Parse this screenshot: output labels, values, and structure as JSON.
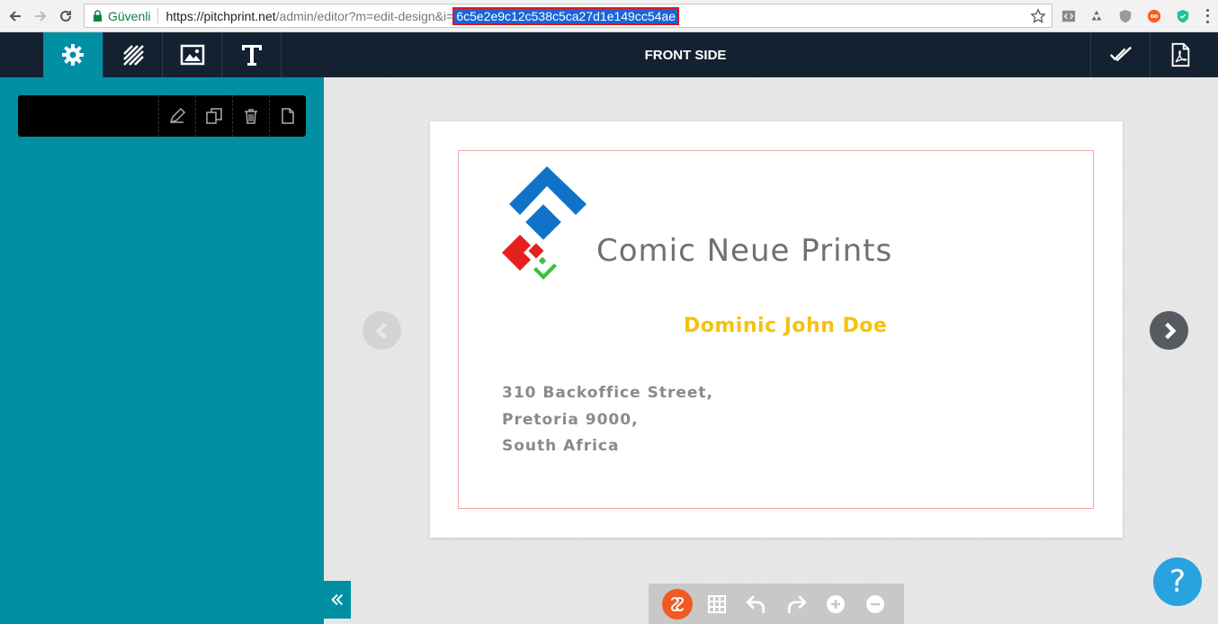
{
  "browser": {
    "secure_label": "Güvenli",
    "url_host": "https://pitchprint.net",
    "url_path": "/admin/editor?m=edit-design&i=",
    "url_selected": "6c5e2e9c12c538c5ca27d1e149cc54ae"
  },
  "header": {
    "title": "FRONT SIDE",
    "tools": [
      "gear-icon",
      "background-pattern-icon",
      "image-icon",
      "text-icon"
    ],
    "right_tools": [
      "checkmark-icon",
      "pdf-icon"
    ]
  },
  "sidebar": {
    "layer_actions": [
      "edit-icon",
      "duplicate-icon",
      "trash-icon",
      "new-page-icon"
    ]
  },
  "card": {
    "company": "Comic Neue Prints",
    "name": "Dominic John Doe",
    "address_line1": "310 Backoffice Street,",
    "address_line2": "Pretoria 9000,",
    "address_line3": "South Africa"
  },
  "bottom_toolbar": [
    "app-logo-icon",
    "grid-icon",
    "undo-icon",
    "redo-icon",
    "zoom-in-icon",
    "zoom-out-icon"
  ],
  "help": {
    "label": "?"
  },
  "colors": {
    "topbar": "#142131",
    "accent": "#008fa3",
    "name_yellow": "#f4c20d",
    "help_blue": "#29a3df"
  }
}
